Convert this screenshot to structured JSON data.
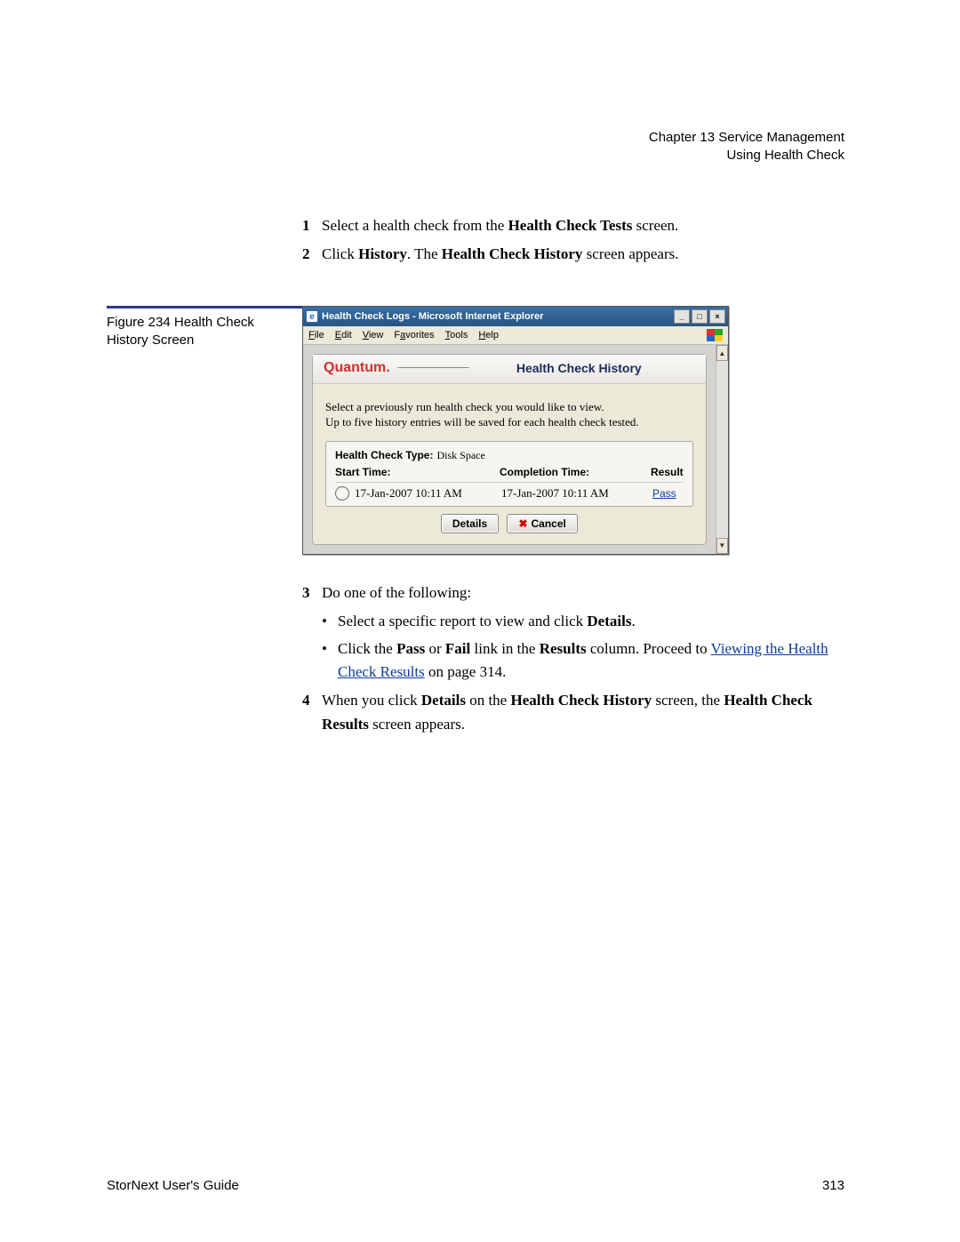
{
  "header": {
    "chapter": "Chapter 13  Service Management",
    "section": "Using Health Check"
  },
  "steps": {
    "s1": {
      "num": "1",
      "pre": "Select a health check from the ",
      "b1": "Health Check Tests",
      "post": " screen."
    },
    "s2": {
      "num": "2",
      "pre": "Click ",
      "b1": "History",
      "mid": ". The ",
      "b2": "Health Check History",
      "post": " screen appears."
    },
    "s3": {
      "num": "3",
      "text": "Do one of the following:"
    },
    "s3a": {
      "pre": "Select a specific report to view and click ",
      "b1": "Details",
      "post": "."
    },
    "s3b": {
      "pre": "Click the ",
      "b1": "Pass",
      "mid1": " or ",
      "b2": "Fail",
      "mid2": " link in the ",
      "b3": "Results",
      "mid3": " column. Proceed to ",
      "link": "Viewing the Health Check Results",
      "post": " on page  314."
    },
    "s4": {
      "num": "4",
      "pre": "When you click ",
      "b1": "Details",
      "mid1": " on the ",
      "b2": "Health Check History",
      "mid2": " screen, the ",
      "b3": "Health Check Results",
      "post": " screen appears."
    }
  },
  "figure": {
    "caption": "Figure 234  Health Check History Screen"
  },
  "window": {
    "title": "Health Check Logs - Microsoft Internet Explorer",
    "menus": [
      "File",
      "Edit",
      "View",
      "Favorites",
      "Tools",
      "Help"
    ],
    "brand": "Quantum.",
    "panel_title": "Health Check History",
    "intro1": "Select a previously run health check you would like to view.",
    "intro2": "Up to five history entries will be saved for each health check tested.",
    "type_label": "Health Check Type:",
    "type_value": "Disk Space",
    "col1": "Start Time:",
    "col2": "Completion Time:",
    "col3": "Result",
    "row": {
      "start": "17-Jan-2007 10:11 AM",
      "end": "17-Jan-2007 10:11 AM",
      "result": "Pass"
    },
    "btn_details": "Details",
    "btn_cancel": "Cancel"
  },
  "footer": {
    "guide": "StorNext User's Guide",
    "page": "313"
  }
}
